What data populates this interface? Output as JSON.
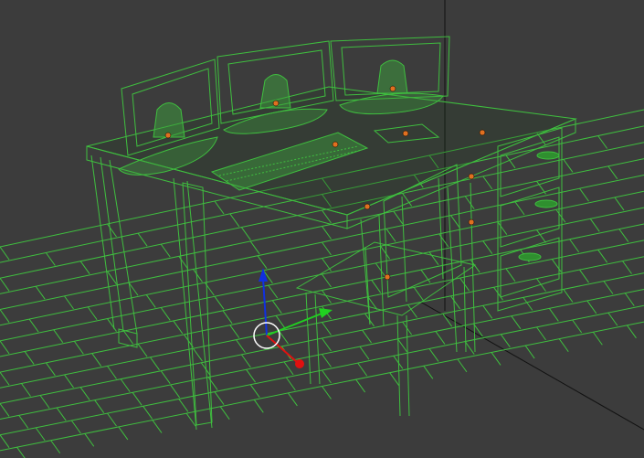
{
  "viewport": {
    "name": "3d-perspective-viewport",
    "background": "#3c3c3c",
    "wire_color": "#3fbf3f",
    "wire_fill": "#2a5a2a",
    "pivot_color": "#e07020",
    "axis_x_color": "#e01010",
    "axis_y_color": "#20d020",
    "axis_z_color": "#1030e0",
    "grid_line_color": "#111111"
  },
  "objects": [
    {
      "name": "desk",
      "icon": "wireframe-mesh"
    },
    {
      "name": "monitor-left",
      "icon": "wireframe-mesh"
    },
    {
      "name": "monitor-center",
      "icon": "wireframe-mesh"
    },
    {
      "name": "monitor-right",
      "icon": "wireframe-mesh"
    },
    {
      "name": "keyboard",
      "icon": "wireframe-mesh"
    },
    {
      "name": "mouse",
      "icon": "wireframe-mesh"
    },
    {
      "name": "chair",
      "icon": "wireframe-mesh"
    },
    {
      "name": "drawer-cabinet",
      "icon": "wireframe-mesh"
    },
    {
      "name": "floor-planks",
      "icon": "wireframe-mesh"
    }
  ],
  "gizmo": {
    "type": "move-transform-gizmo",
    "axes": [
      "x",
      "y",
      "z"
    ]
  }
}
